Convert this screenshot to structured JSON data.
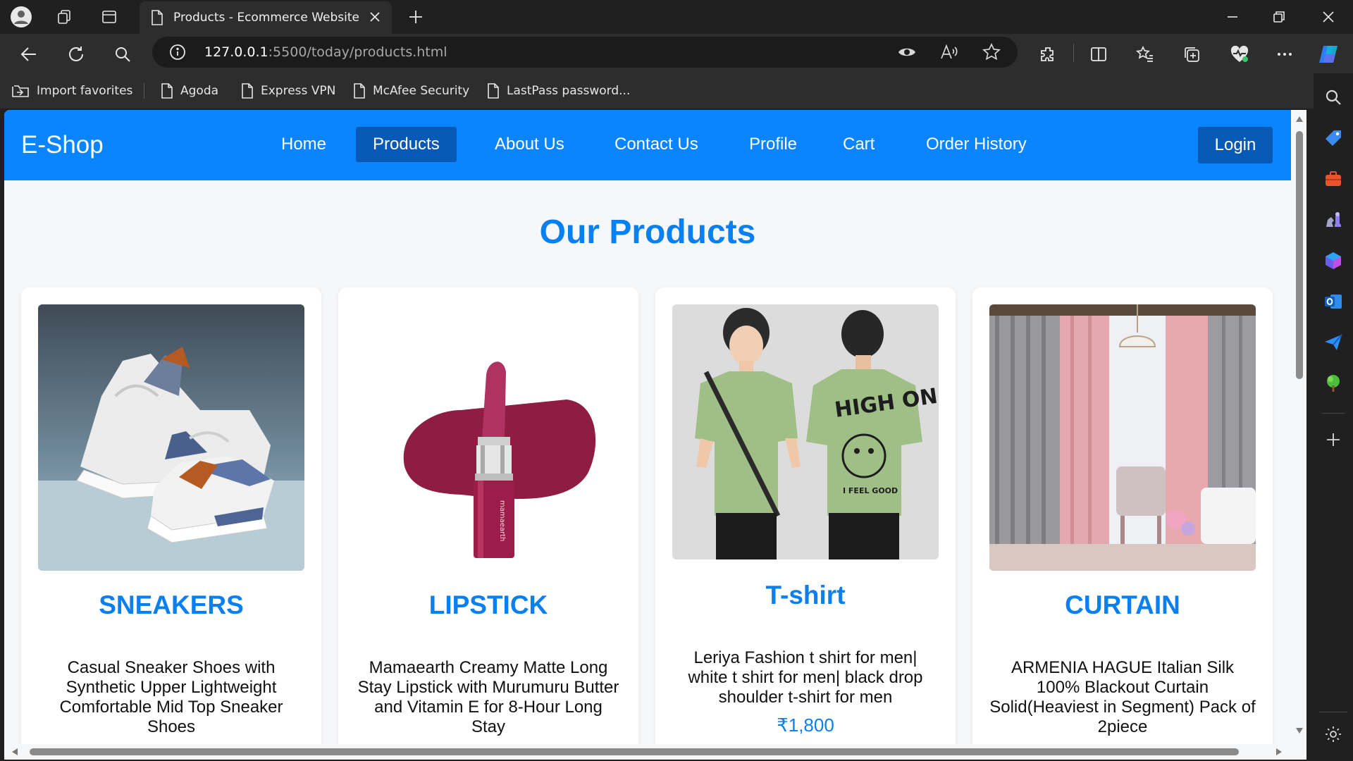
{
  "browser": {
    "tab": {
      "title": "Products - Ecommerce Website"
    },
    "url": {
      "host": "127.0.0.1",
      "rest": ":5500/today/products.html"
    },
    "favorites": [
      {
        "label": "Import favorites",
        "icon": "import-icon"
      },
      {
        "label": "Agoda",
        "icon": "page-icon"
      },
      {
        "label": "Express VPN",
        "icon": "page-icon"
      },
      {
        "label": "McAfee Security",
        "icon": "page-icon"
      },
      {
        "label": "LastPass password...",
        "icon": "page-icon"
      }
    ],
    "colors": {
      "chrome_dark": "#202020",
      "chrome": "#2d2d2d",
      "addressbar": "#1b1b1b"
    }
  },
  "site": {
    "brand": "E-Shop",
    "nav": [
      {
        "label": "Home"
      },
      {
        "label": "Products",
        "active": true
      },
      {
        "label": "About Us"
      },
      {
        "label": "Contact Us"
      },
      {
        "label": "Profile"
      },
      {
        "label": "Cart"
      },
      {
        "label": "Order History"
      }
    ],
    "login": "Login",
    "section_title": "Our Products",
    "colors": {
      "primary": "#0a84ff",
      "primary_dark": "#0859b5",
      "accent_text": "#0a7fef",
      "page_bg": "#f6f7f9"
    },
    "products": [
      {
        "name": "SNEAKERS",
        "description": "Casual Sneaker Shoes with Synthetic Upper Lightweight Comfortable Mid Top Sneaker Shoes",
        "image": "sneakers-image"
      },
      {
        "name": "LIPSTICK",
        "description": "Mamaearth Creamy Matte Long Stay Lipstick with Murumuru Butter and Vitamin E for 8-Hour Long Stay",
        "image": "lipstick-image"
      },
      {
        "name": "T-shirt",
        "description": "Leriya Fashion t shirt for men| white t shirt for men| black drop shoulder t-shirt for men",
        "price": "₹1,800",
        "image": "tshirt-image"
      },
      {
        "name": "CURTAIN",
        "description": "ARMENIA HAGUE Italian Silk 100% Blackout Curtain Solid(Heaviest in Segment) Pack of 2piece",
        "image": "curtain-image"
      }
    ]
  }
}
